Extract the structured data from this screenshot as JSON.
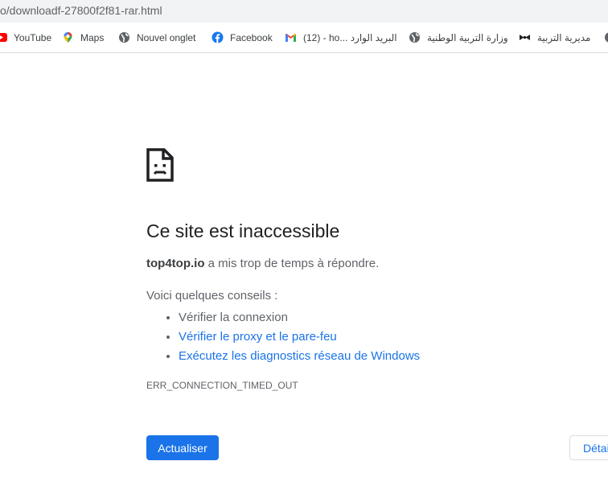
{
  "browser": {
    "url": "o/downloadf-27800f2f81-rar.html",
    "bookmarks": [
      {
        "label": "YouTube",
        "icon": "youtube-icon"
      },
      {
        "label": "Maps",
        "icon": "maps-icon"
      },
      {
        "label": "Nouvel onglet",
        "icon": "globe-icon"
      },
      {
        "label": "Facebook",
        "icon": "facebook-icon"
      },
      {
        "label": "(12) - ho... البريد الوارد",
        "icon": "gmail-icon"
      },
      {
        "label": "وزارة التربية الوطنية",
        "icon": "globe-icon"
      },
      {
        "label": "مديرية التربية",
        "icon": "bowtie-icon"
      }
    ]
  },
  "error_page": {
    "icon": "sad-page-icon",
    "title": "Ce site est inaccessible",
    "host": "top4top.io",
    "summary_suffix": " a mis trop de temps à répondre.",
    "tips_intro": "Voici quelques conseils :",
    "tips": [
      "Vérifier la connexion",
      "Vérifier le proxy et le pare-feu",
      "Exécutez les diagnostics réseau de Windows"
    ],
    "error_code": "ERR_CONNECTION_TIMED_OUT",
    "reload_label": "Actualiser",
    "details_label": "Détails"
  },
  "colors": {
    "accent": "#1a73e8",
    "text": "#5f6368",
    "title": "#202124"
  }
}
